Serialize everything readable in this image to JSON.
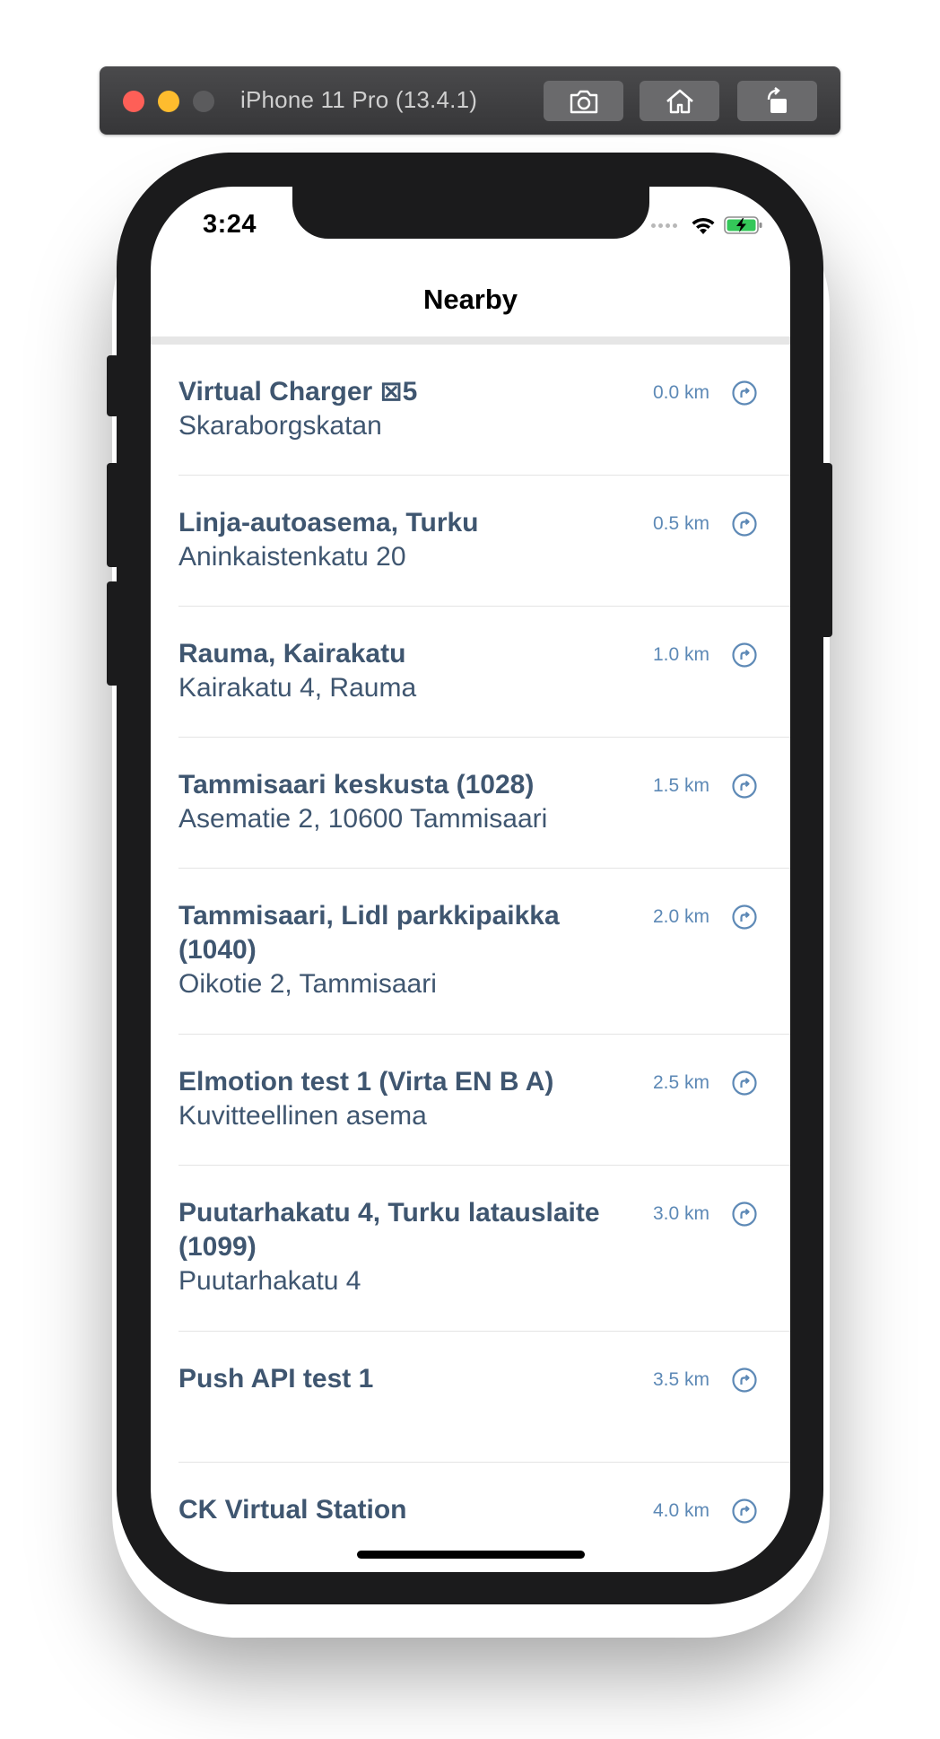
{
  "simulator": {
    "title": "iPhone 11 Pro (13.4.1)",
    "buttons": [
      "screenshot-icon",
      "home-icon",
      "rotate-icon"
    ]
  },
  "status_bar": {
    "time": "3:24",
    "icons": [
      "wifi-icon",
      "battery-charging-icon"
    ]
  },
  "nav": {
    "title": "Nearby"
  },
  "stations": [
    {
      "name": "Virtual Charger ⊠5",
      "address": "Skaraborgskatan",
      "distance": "0.0 km"
    },
    {
      "name": "Linja-autoasema, Turku",
      "address": "Aninkaistenkatu 20",
      "distance": "0.5 km"
    },
    {
      "name": "Rauma, Kairakatu",
      "address": "Kairakatu 4, Rauma",
      "distance": "1.0 km"
    },
    {
      "name": "Tammisaari keskusta (1028)",
      "address": "Asematie 2, 10600 Tammisaari",
      "distance": "1.5 km"
    },
    {
      "name": "Tammisaari, Lidl parkkipaikka (1040)",
      "address": "Oikotie 2, Tammisaari",
      "distance": "2.0 km"
    },
    {
      "name": "Elmotion test 1 (Virta EN B A)",
      "address": "Kuvitteellinen asema",
      "distance": "2.5 km"
    },
    {
      "name": "Puutarhakatu 4, Turku latauslaite (1099)",
      "address": "Puutarhakatu 4",
      "distance": "3.0 km"
    },
    {
      "name": "Push API test 1",
      "address": "",
      "distance": "3.5 km"
    },
    {
      "name": "CK Virtual Station",
      "address": "",
      "distance": "4.0 km"
    }
  ],
  "colors": {
    "text": "#3f5670",
    "distance": "#5d89b6",
    "separator": "#e4e4e4"
  }
}
